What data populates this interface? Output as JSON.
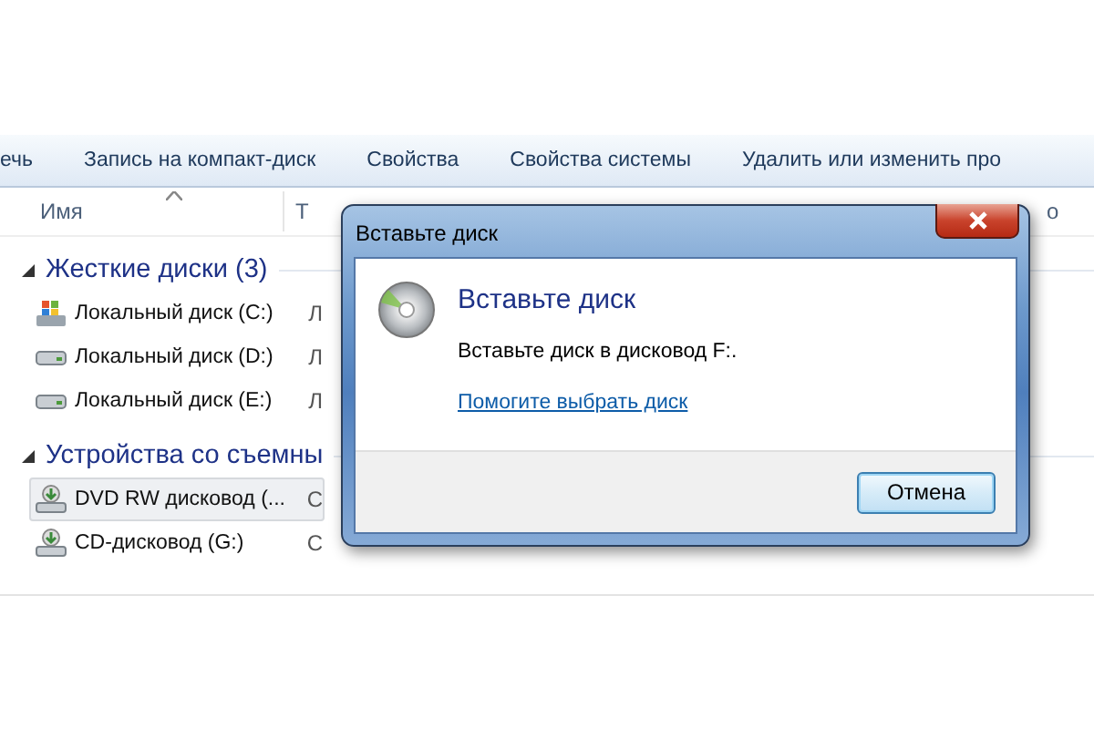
{
  "toolbar": {
    "items": [
      "ечь",
      "Запись на компакт-диск",
      "Свойства",
      "Свойства системы",
      "Удалить или изменить про"
    ]
  },
  "columns": [
    {
      "label": "Имя",
      "sorted": true
    },
    {
      "label": "Т",
      "sorted": false
    }
  ],
  "right_edge_text": "о",
  "groups": [
    {
      "title": "Жесткие диски (3)",
      "expanded": true,
      "items": [
        {
          "kind": "system",
          "name": "Локальный диск (C:)",
          "column_2": "Л",
          "selected": false
        },
        {
          "kind": "hdd",
          "name": "Локальный диск (D:)",
          "column_2": "Л",
          "selected": false
        },
        {
          "kind": "hdd",
          "name": "Локальный диск (E:)",
          "column_2": "Л",
          "selected": false
        }
      ]
    },
    {
      "title": "Устройства со съемны",
      "expanded": true,
      "items": [
        {
          "kind": "optical",
          "name": "DVD RW дисковод (...",
          "column_2": "С",
          "selected": true
        },
        {
          "kind": "optical",
          "name": "CD-дисковод (G:)",
          "column_2": "С",
          "selected": false
        }
      ]
    }
  ],
  "dialog": {
    "title": "Вставьте диск",
    "heading": "Вставьте диск",
    "message": "Вставьте диск в дисковод F:.",
    "link": "Помогите выбрать диск",
    "button": "Отмена"
  }
}
